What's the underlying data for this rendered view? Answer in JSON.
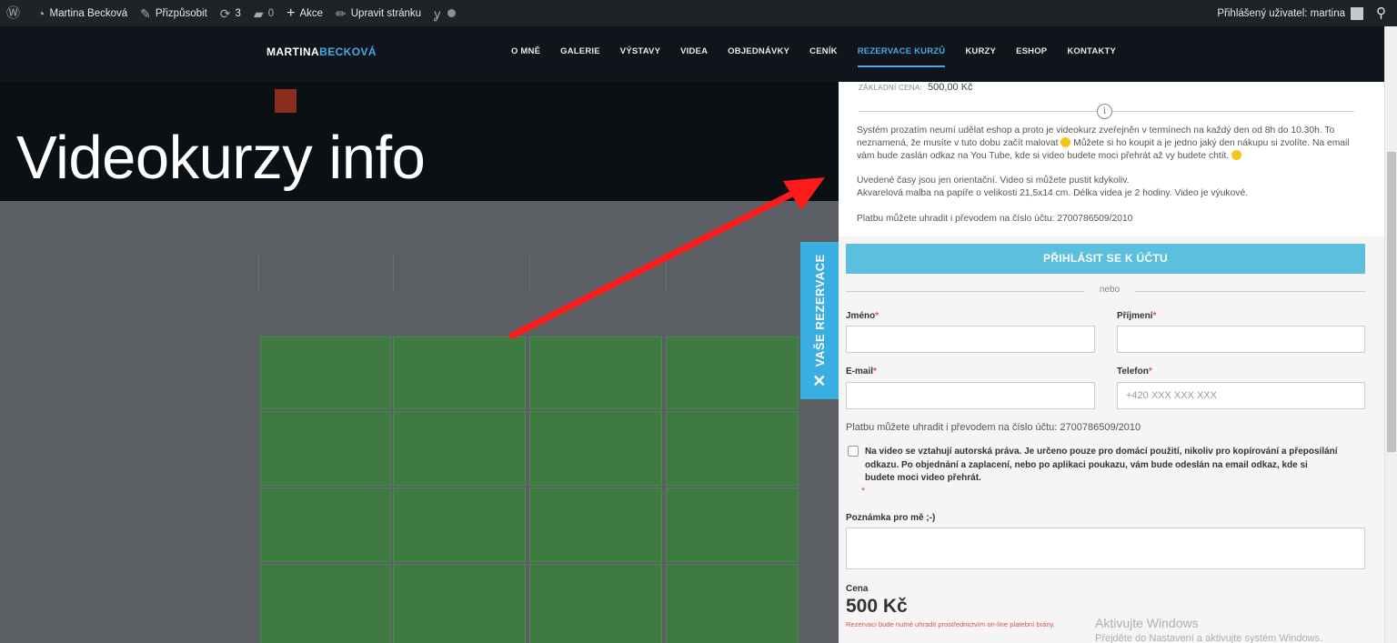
{
  "adminbar": {
    "site_name": "Martina Becková",
    "customize": "Přizpůsobit",
    "updates_count": "3",
    "comments_count": "0",
    "new_label": "Akce",
    "edit_page": "Upravit stránku",
    "logged_user": "Přihlášený uživatel: martina"
  },
  "header": {
    "logo_part1": "MARTINA",
    "logo_part2": "BECKOVÁ",
    "nav": [
      "O MNĚ",
      "GALERIE",
      "VÝSTAVY",
      "VIDEA",
      "OBJEDNÁVKY",
      "CENÍK",
      "REZERVACE KURZŮ",
      "KURZY",
      "ESHOP",
      "KONTAKTY"
    ],
    "active_nav": "REZERVACE KURZŮ"
  },
  "overlay": {
    "title": "Videokurzy info",
    "arrow_color": "#ff1a1a"
  },
  "sidetab": {
    "label": "VAŠE REZERVACE",
    "close_glyph": "✕"
  },
  "panel": {
    "base_price_label": "ZÁKLADNÍ CENA:",
    "base_price_value": "500,00 Kč",
    "desc_p1a": "Systém prozatím neumí udělat eshop a proto je videokurz zveřejněn v termínech na každý den od 8h do 10.30h. To neznamená, že musíte v tuto dobu začít malovat ",
    "desc_p1b": " Můžete si ho koupit a je jedno jaký den nákupu si zvolíte. Na email vám bude zaslán odkaz na You Tube, kde si video budete moci přehrát až vy budete chtít. ",
    "desc_p2a": "Uvedené časy jsou jen orientační. Video si můžete pustit kdykoliv.",
    "desc_p2b": "Akvarelová malba na papíře o velikosti 21,5x14 cm. Délka videa je 2 hodiny. Video je výukové.",
    "desc_p3": "Platbu můžete uhradit i převodem na číslo účtu: 2700786509/2010",
    "login_button": "PŘIHLÁSIT SE K ÚČTU",
    "or": "nebo",
    "first_name_label": "Jméno",
    "last_name_label": "Příjmení",
    "email_label": "E-mail",
    "phone_label": "Telefon",
    "phone_placeholder": "+420 XXX XXX XXX",
    "required_mark": "*",
    "pay_note": "Platbu můžete uhradit i převodem na číslo účtu: 2700786509/2010",
    "agreement": "Na video se vztahují autorská práva. Je určeno pouze pro domácí použití, nikoliv pro kopírování a přeposílání odkazu. Po objednání a zaplacení, nebo po aplikaci poukazu, vám bude odeslán na email odkaz, kde si budete moci video přehrát.",
    "note_label": "Poznámka pro mě ;-)",
    "price_label": "Cena",
    "price_value": "500 Kč",
    "payment_warning": "Rezervaci bude nutné uhradit prostřednictvím on-line platební brány."
  },
  "windows": {
    "line1": "Aktivujte Windows",
    "line2": "Přejděte do Nastavení a aktivujte systém Windows."
  }
}
